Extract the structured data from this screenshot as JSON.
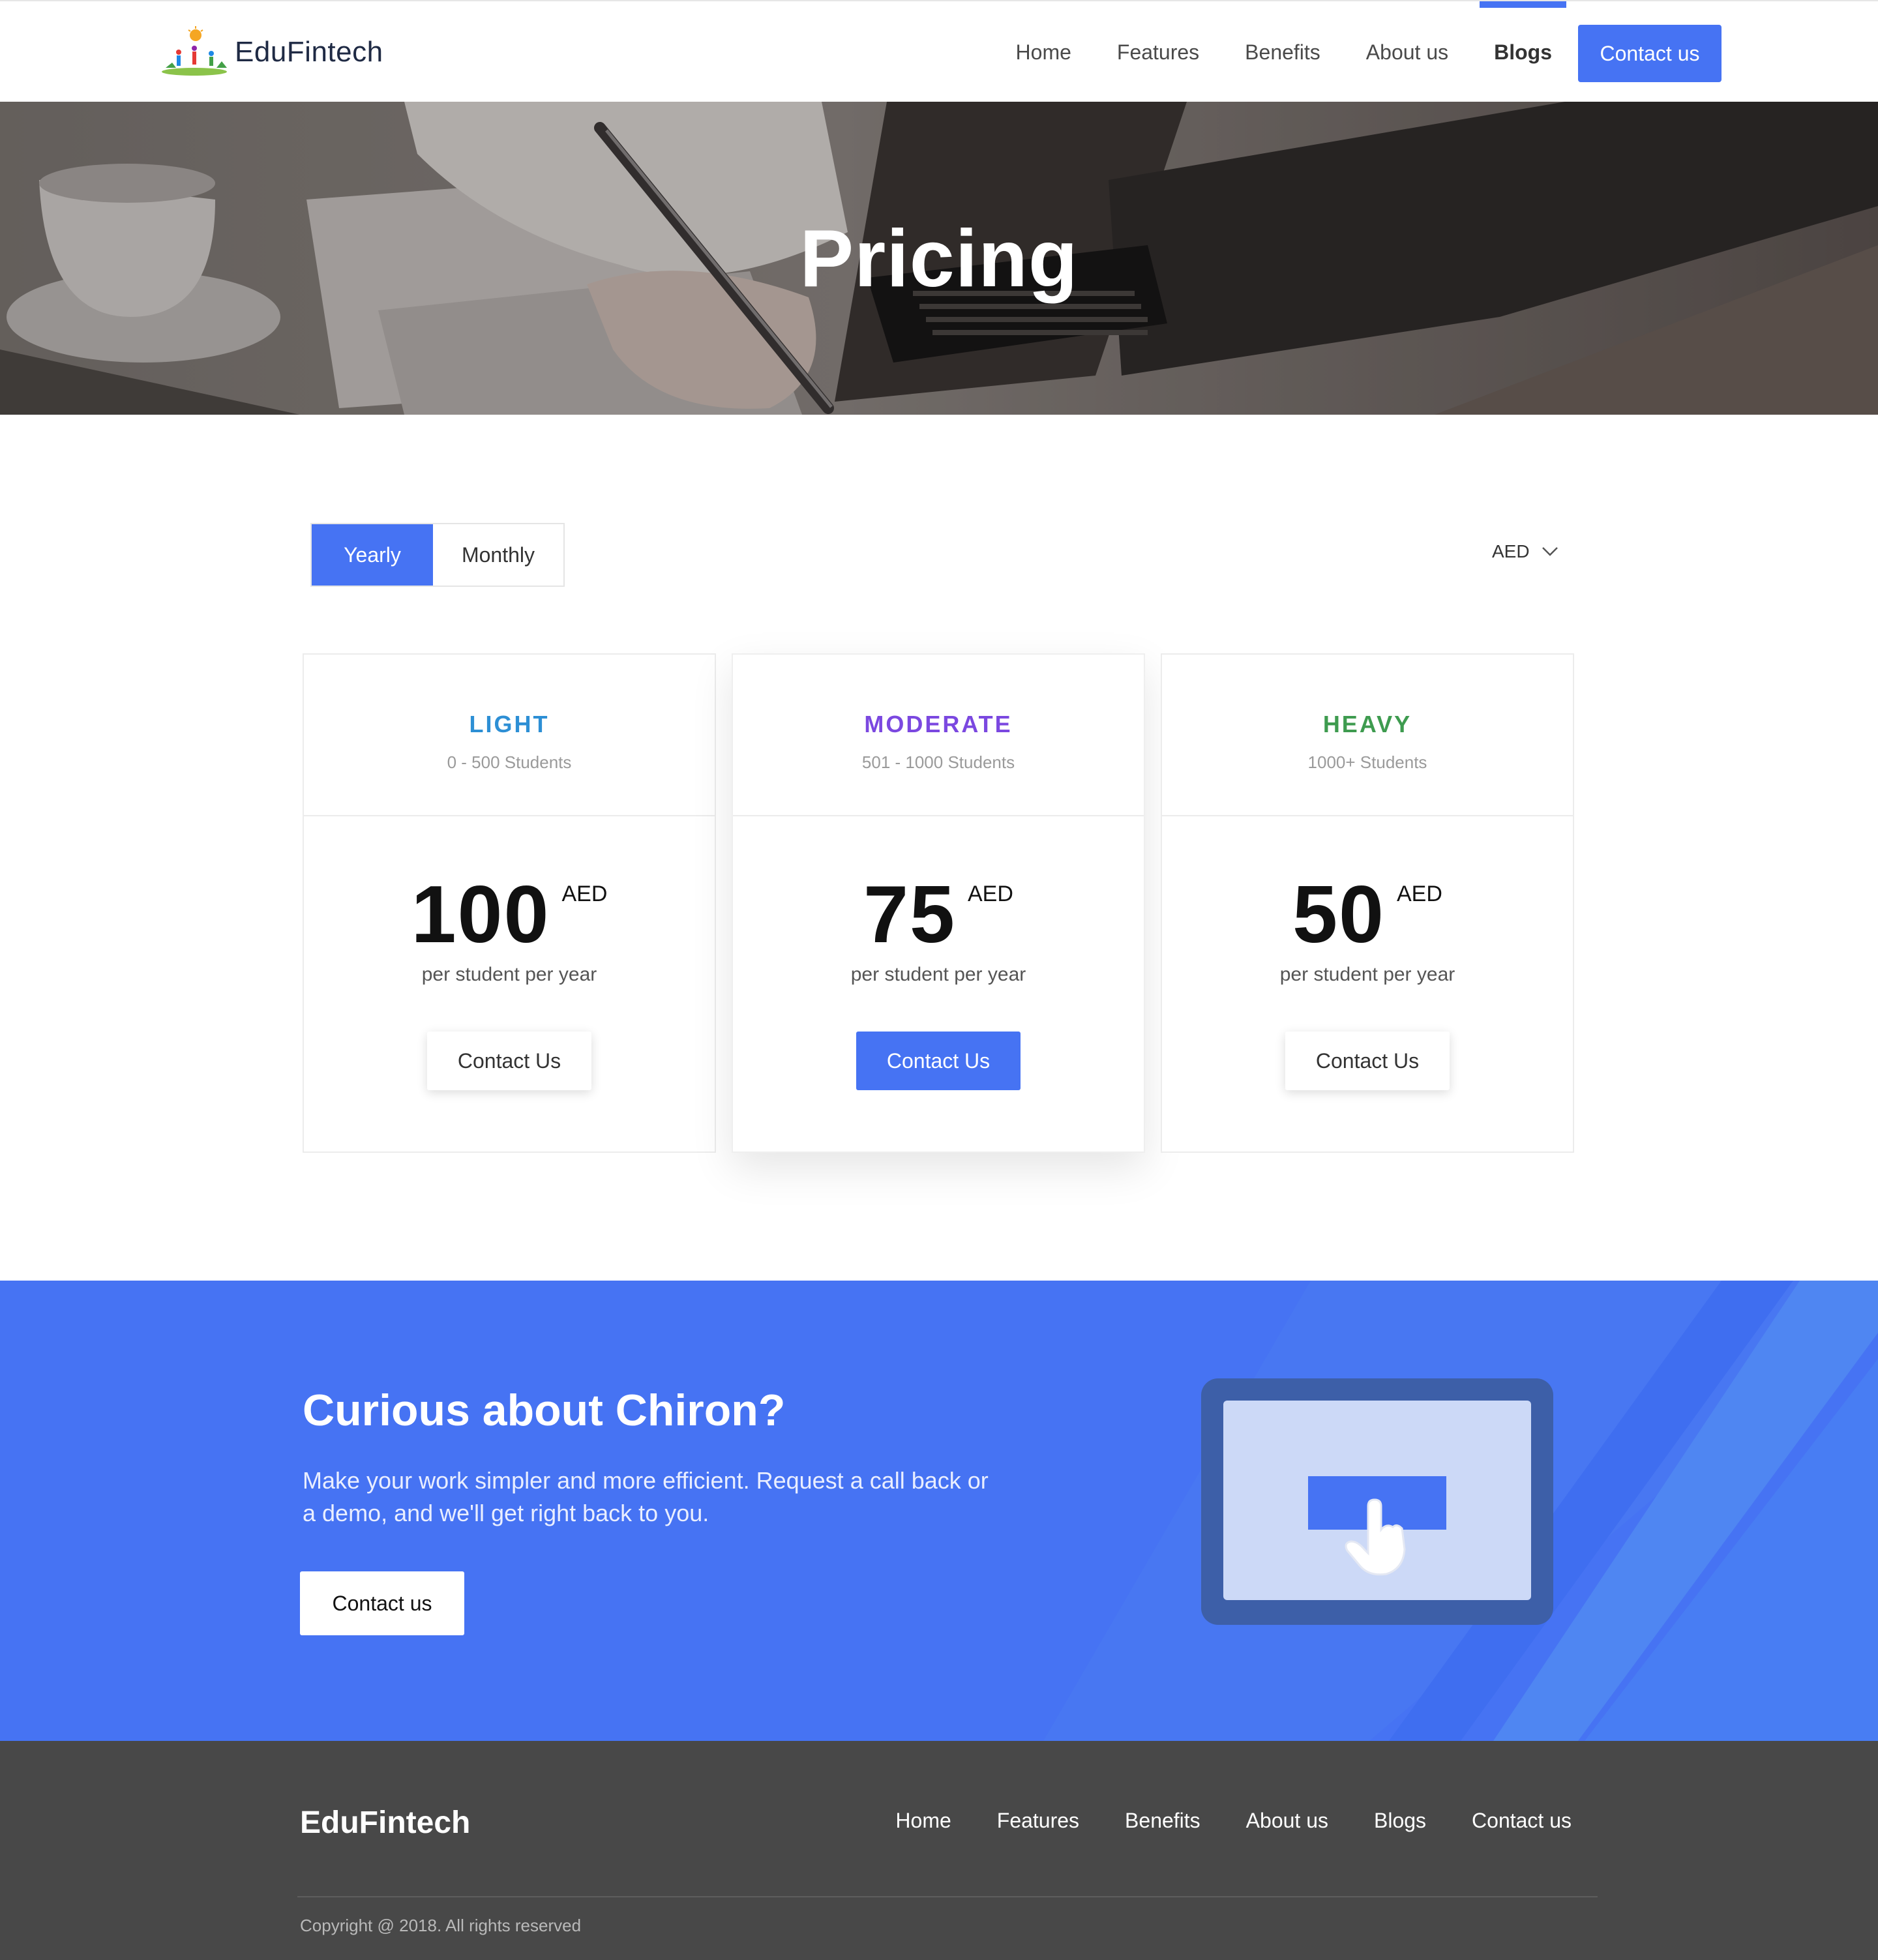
{
  "nav": {
    "brand": "EduFintech",
    "links": [
      "Home",
      "Features",
      "Benefits",
      "About us",
      "Blogs"
    ],
    "active": "Blogs",
    "cta": "Contact us"
  },
  "hero": {
    "title": "Pricing"
  },
  "pricing": {
    "toggle": {
      "yearly": "Yearly",
      "monthly": "Monthly",
      "selected": "Yearly"
    },
    "currency": "AED",
    "plans": [
      {
        "name": "LIGHT",
        "range": "0 - 500 Students",
        "price": "100",
        "currency": "AED",
        "unit": "per student per year",
        "button": "Contact Us",
        "color": "#2d8fd5"
      },
      {
        "name": "MODERATE",
        "range": "501 - 1000 Students",
        "price": "75",
        "currency": "AED",
        "unit": "per student per year",
        "button": "Contact Us",
        "color": "#7b48e0"
      },
      {
        "name": "HEAVY",
        "range": "1000+  Students",
        "price": "50",
        "currency": "AED",
        "unit": "per student per year",
        "button": "Contact Us",
        "color": "#3e9b4f"
      }
    ]
  },
  "cta": {
    "title": "Curious about Chiron?",
    "text": "Make your work simpler and more efficient. Request a call back or a demo, and we'll get right back to you.",
    "button": "Contact us"
  },
  "footer": {
    "brand": "EduFintech",
    "links": [
      "Home",
      "Features",
      "Benefits",
      "About us",
      "Blogs",
      "Contact us"
    ],
    "copyright": "Copyright @ 2018. All rights reserved"
  },
  "colors": {
    "accent": "#4673f3",
    "footer_bg": "#484848"
  }
}
